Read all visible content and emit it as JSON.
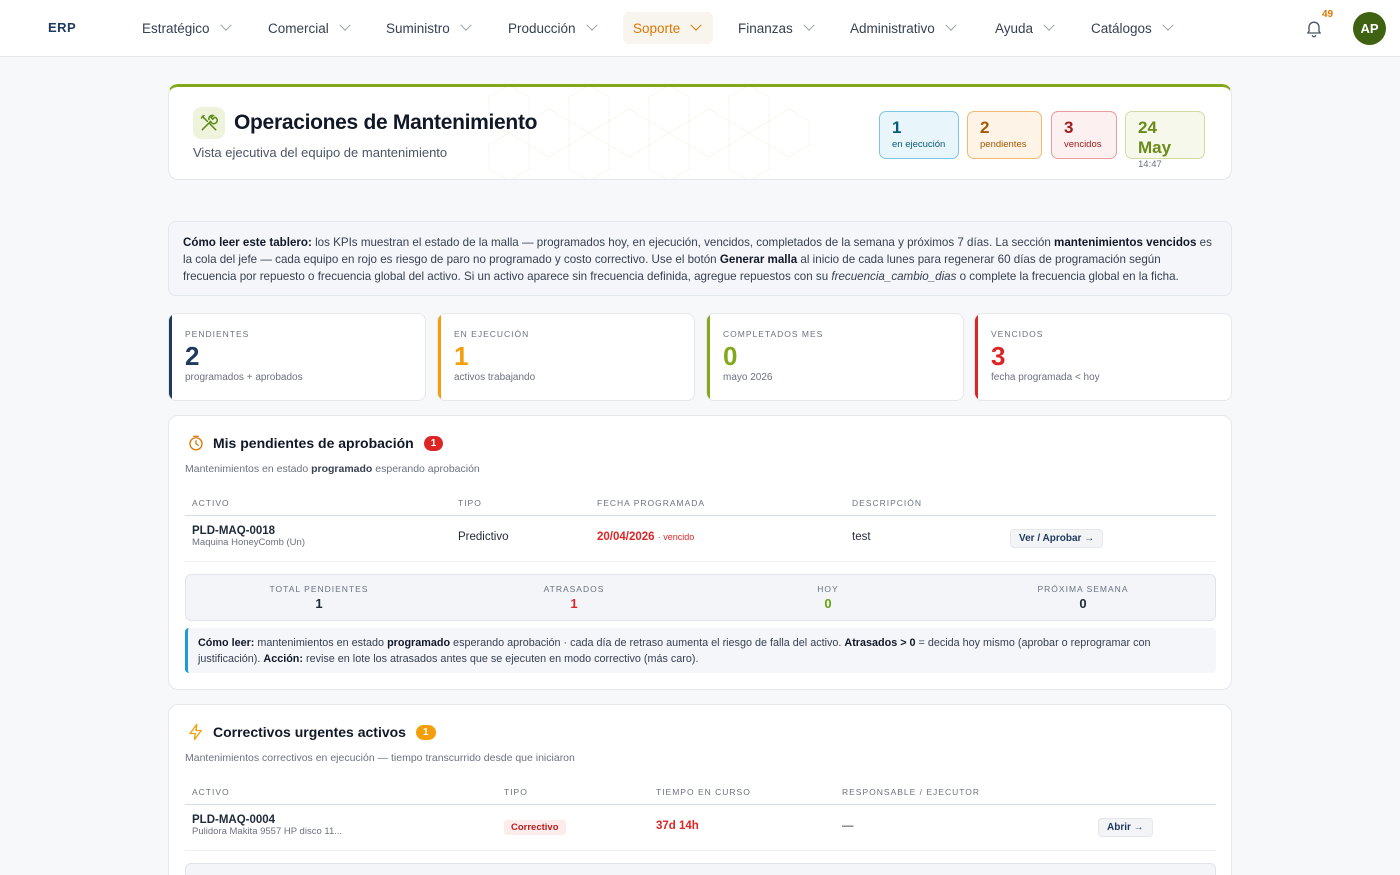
{
  "nav": {
    "brand": "ERP",
    "items": [
      {
        "label": "Estratégico"
      },
      {
        "label": "Comercial"
      },
      {
        "label": "Suministro"
      },
      {
        "label": "Producción"
      },
      {
        "label": "Soporte"
      },
      {
        "label": "Finanzas"
      },
      {
        "label": "Administrativo"
      },
      {
        "label": "Ayuda"
      },
      {
        "label": "Catálogos"
      }
    ],
    "active": "Soporte",
    "notifications": "49",
    "avatar": "AP"
  },
  "hero": {
    "title": "Operaciones de Mantenimiento",
    "subtitle": "Vista ejecutiva del equipo de mantenimiento",
    "pills": [
      {
        "value": "1",
        "label": "en ejecución"
      },
      {
        "value": "2",
        "label": "pendientes"
      },
      {
        "value": "3",
        "label": "vencidos"
      },
      {
        "value": "24 May",
        "label": "14:47"
      }
    ],
    "accent_color": "#84a81c"
  },
  "info": {
    "lead": "Cómo leer este tablero:",
    "t1": " los KPIs muestran el estado de la malla — programados hoy, en ejecución, vencidos, completados de la semana y próximos 7 días. La sección ",
    "b1": "mantenimientos vencidos",
    "t2": " es la cola del jefe — cada equipo en rojo es riesgo de paro no programado y costo correctivo. Use el botón ",
    "b2": "Generar malla",
    "t3": " al inicio de cada lunes para regenerar 60 días de programación según frecuencia por repuesto o frecuencia global del activo. Si un activo aparece sin frecuencia definida, agregue repuestos con su ",
    "i1": "frecuencia_cambio_dias",
    "t4": " o complete la frecuencia global en la ficha."
  },
  "kpis": [
    {
      "label": "PENDIENTES",
      "value": "2",
      "sub": "programados + aprobados",
      "color": "#1e3a5f"
    },
    {
      "label": "EN EJECUCIÓN",
      "value": "1",
      "sub": "activos trabajando",
      "color": "#f59e0b"
    },
    {
      "label": "COMPLETADOS MES",
      "value": "0",
      "sub": "mayo 2026",
      "color": "#84a81c"
    },
    {
      "label": "VENCIDOS",
      "value": "3",
      "sub": "fecha programada < hoy",
      "color": "#dc2626"
    }
  ],
  "approvals": {
    "title": "Mis pendientes de aprobación",
    "badge": "1",
    "desc_a": "Mantenimientos en estado ",
    "desc_b": "programado",
    "desc_c": " esperando aprobación",
    "columns": [
      "ACTIVO",
      "TIPO",
      "FECHA PROGRAMADA",
      "DESCRIPCIÓN"
    ],
    "rows": [
      {
        "asset": "PLD-MAQ-0018",
        "asset_sub": "Maquina HoneyComb (Un)",
        "type": "Predictivo",
        "date": "20/04/2026",
        "date_note": "· vencido",
        "description": "test",
        "action": "Ver / Aprobar →"
      }
    ],
    "stats": [
      {
        "label": "TOTAL PENDIENTES",
        "value": "1"
      },
      {
        "label": "ATRASADOS",
        "value": "1"
      },
      {
        "label": "HOY",
        "value": "0"
      },
      {
        "label": "PRÓXIMA SEMANA",
        "value": "0"
      }
    ],
    "howto": {
      "b1": "Cómo leer:",
      "t1": " mantenimientos en estado ",
      "b2": "programado",
      "t2": " esperando aprobación · cada día de retraso aumenta el riesgo de falla del activo. ",
      "b3": "Atrasados > 0",
      "t3": " = decida hoy mismo (aprobar o reprogramar con justificación). ",
      "b4": "Acción:",
      "t4": " revise en lote los atrasados antes que se ejecuten en modo correctivo (más caro)."
    }
  },
  "urgent": {
    "title": "Correctivos urgentes activos",
    "badge": "1",
    "desc": "Mantenimientos correctivos en ejecución — tiempo transcurrido desde que iniciaron",
    "columns": [
      "ACTIVO",
      "TIPO",
      "TIEMPO EN CURSO",
      "RESPONSABLE / EJECUTOR"
    ],
    "rows": [
      {
        "asset": "PLD-MAQ-0004",
        "asset_sub": "Pulidora Makita 9557 HP disco 11...",
        "type": "Correctivo",
        "elapsed": "37d 14h",
        "owner": "—",
        "action": "Abrir →"
      }
    ]
  }
}
